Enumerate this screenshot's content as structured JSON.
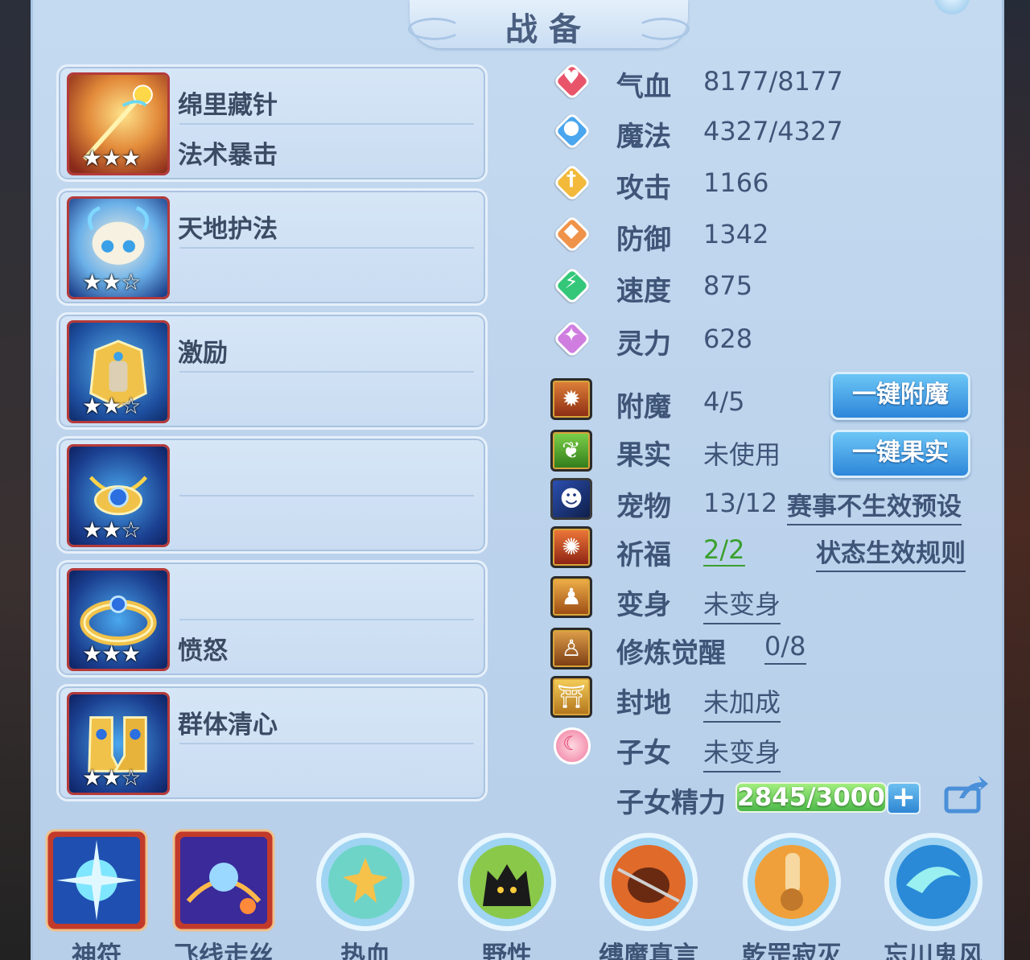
{
  "title": "战备",
  "skills": [
    {
      "lines": [
        "绵里藏针",
        "法术暴击"
      ],
      "stars": "★★★",
      "icon": "golden-staff-icon"
    },
    {
      "lines": [
        "天地护法",
        ""
      ],
      "stars": "★★☆",
      "icon": "white-hat-helmet-icon"
    },
    {
      "lines": [
        "激励",
        ""
      ],
      "stars": "★★☆",
      "icon": "golden-armor-icon"
    },
    {
      "lines": [
        "",
        ""
      ],
      "stars": "★★☆",
      "icon": "blue-gem-necklace-icon"
    },
    {
      "lines": [
        "",
        "愤怒"
      ],
      "stars": "★★★",
      "icon": "golden-ring-icon"
    },
    {
      "lines": [
        "群体清心",
        ""
      ],
      "stars": "★★☆",
      "icon": "golden-boots-icon"
    }
  ],
  "stats": [
    {
      "label": "气血",
      "value": "8177/8177",
      "icon": "heart-icon",
      "color": "#e8556a"
    },
    {
      "label": "魔法",
      "value": "4327/4327",
      "icon": "mana-icon",
      "color": "#4aa6ee"
    },
    {
      "label": "攻击",
      "value": "1166",
      "icon": "sword-icon",
      "color": "#f2b93a"
    },
    {
      "label": "防御",
      "value": "1342",
      "icon": "shield-icon",
      "color": "#f0934a"
    },
    {
      "label": "速度",
      "value": "875",
      "icon": "speed-icon",
      "color": "#34c77a"
    },
    {
      "label": "灵力",
      "value": "628",
      "icon": "spirit-icon",
      "color": "#cf7ee0"
    }
  ],
  "extras": {
    "enchant": {
      "label": "附魔",
      "value": "4/5",
      "button": "一键附魔"
    },
    "fruit": {
      "label": "果实",
      "value": "未使用",
      "button": "一键果实"
    },
    "pet": {
      "label": "宠物",
      "value": "13/12",
      "link": "赛事不生效预设"
    },
    "blessing": {
      "label": "祈福",
      "value": "2/2",
      "link": "状态生效规则"
    },
    "transform": {
      "label": "变身",
      "value": "未变身"
    },
    "cultivation": {
      "label": "修炼觉醒",
      "value": "0/8"
    },
    "fief": {
      "label": "封地",
      "value": "未加成"
    },
    "children": {
      "label": "子女",
      "value": "未变身"
    },
    "child_energy": {
      "label": "子女精力",
      "value": "2845/3000",
      "fill": 0.948
    }
  },
  "bottom_skills": [
    {
      "label": "神符",
      "icon": "blue-star-rune-icon"
    },
    {
      "label": "飞线走丝",
      "icon": "purple-lotus-icon"
    },
    {
      "label": "热血",
      "icon": "golden-figure-icon"
    },
    {
      "label": "野性",
      "icon": "black-beast-icon"
    },
    {
      "label": "缚魔真言",
      "icon": "chained-demon-icon"
    },
    {
      "label": "乾罡寂灭",
      "icon": "monk-fist-icon"
    },
    {
      "label": "忘川鬼风",
      "icon": "blue-wind-icon"
    }
  ]
}
